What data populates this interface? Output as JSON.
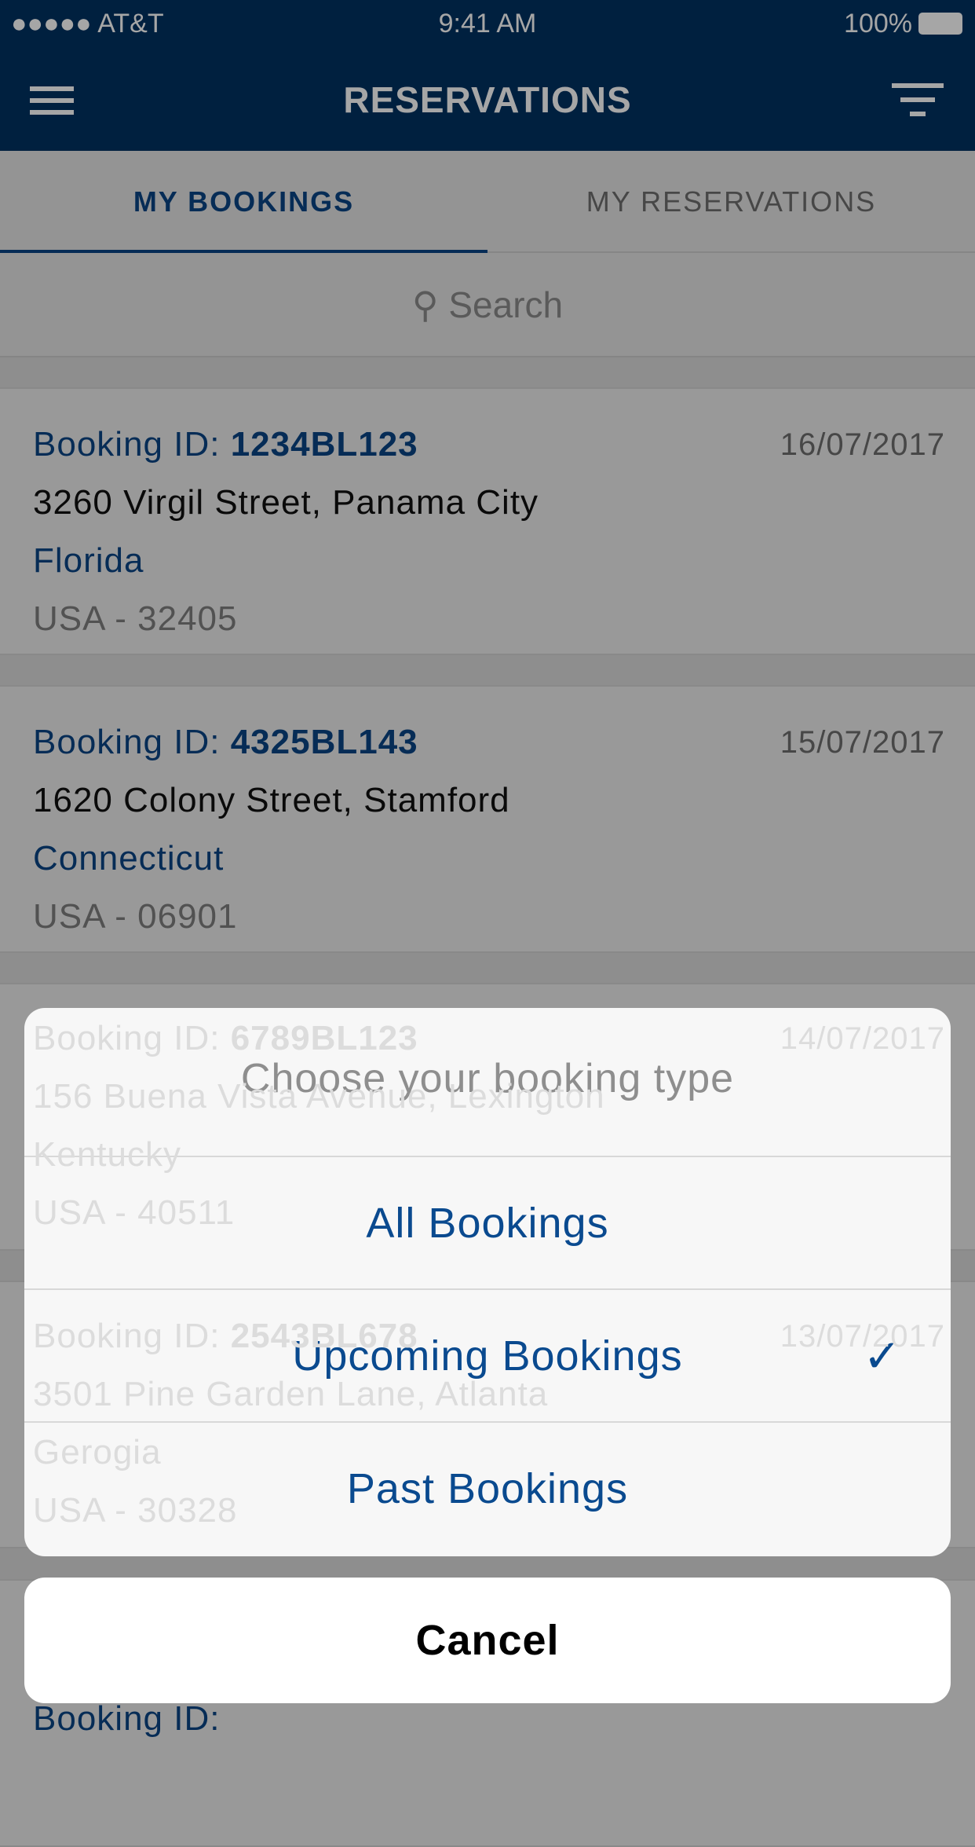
{
  "status_bar": {
    "carrier": "●●●●● AT&T",
    "time": "9:41 AM",
    "battery": "100%"
  },
  "header": {
    "title": "RESERVATIONS"
  },
  "tabs": [
    {
      "label": "MY BOOKINGS"
    },
    {
      "label": "MY RESERVATIONS"
    }
  ],
  "search": {
    "placeholder": "Search"
  },
  "bookings": [
    {
      "id_label": "Booking ID: ",
      "id": "1234BL123",
      "date": "16/07/2017",
      "address": "3260 Virgil Street, Panama City",
      "state": "Florida",
      "zip": "USA - 32405"
    },
    {
      "id_label": "Booking ID: ",
      "id": "4325BL143",
      "date": "15/07/2017",
      "address": "1620 Colony Street, Stamford",
      "state": "Connecticut",
      "zip": "USA - 06901"
    },
    {
      "id_label": "Booking ID: ",
      "id": "6789BL123",
      "date": "14/07/2017",
      "address": "156 Buena Vista Avenue, Lexington",
      "state": "Kentucky",
      "zip": "USA - 40511"
    },
    {
      "id_label": "Booking ID: ",
      "id": "2543BL678",
      "date": "13/07/2017",
      "address": "3501 Pine Garden Lane, Atlanta",
      "state": "Gerogia",
      "zip": "USA - 30328"
    },
    {
      "id_label": "Booking ID: "
    }
  ],
  "action_sheet": {
    "title": "Choose your booking type",
    "options": [
      {
        "label": "All Bookings"
      },
      {
        "label": "Upcoming Bookings",
        "check": "✓"
      },
      {
        "label": "Past Bookings"
      }
    ],
    "cancel": "Cancel"
  }
}
